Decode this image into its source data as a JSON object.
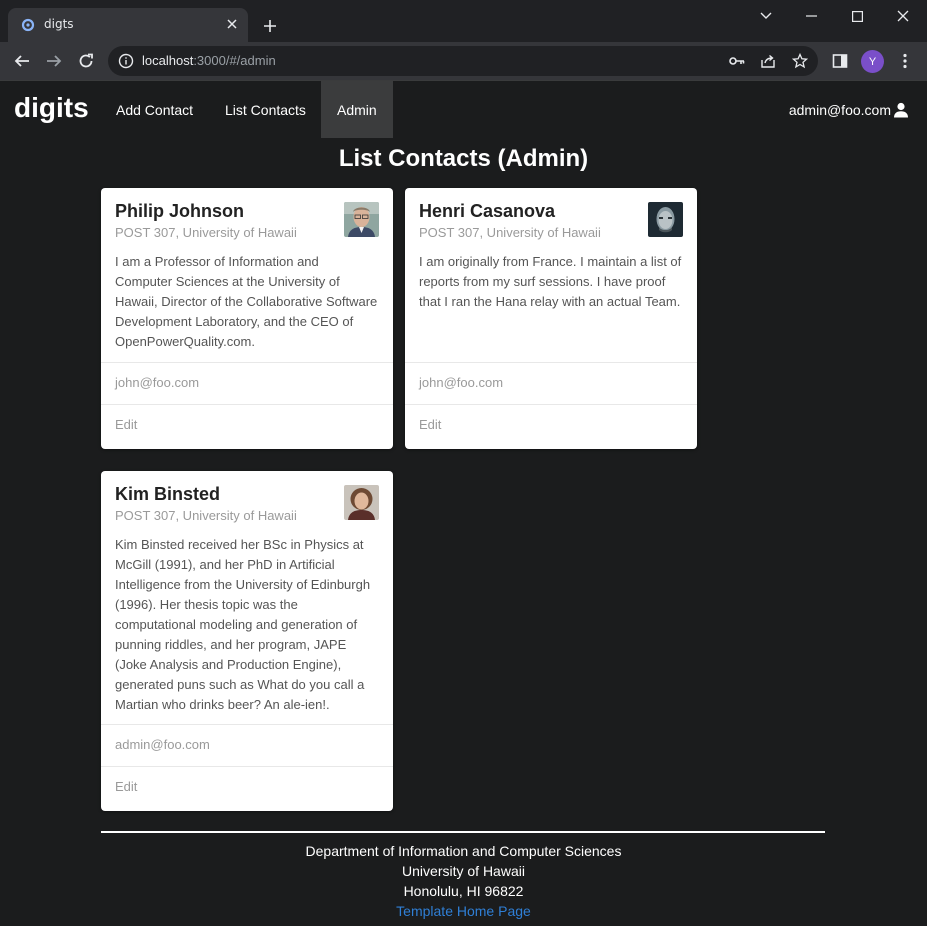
{
  "browser": {
    "tab_title": "digts",
    "url_host": "localhost",
    "url_rest": ":3000/#/admin",
    "profile_initial": "Y"
  },
  "nav": {
    "brand": "digits",
    "items": [
      {
        "label": "Add Contact"
      },
      {
        "label": "List Contacts"
      },
      {
        "label": "Admin"
      }
    ],
    "user_email": "admin@foo.com"
  },
  "page": {
    "title": "List Contacts (Admin)"
  },
  "contacts": [
    {
      "name": "Philip Johnson",
      "address": "POST 307, University of Hawaii",
      "description": "I am a Professor of Information and Computer Sciences at the University of Hawaii, Director of the Collaborative Software Development Laboratory, and the CEO of OpenPowerQuality.com.",
      "owner": "john@foo.com",
      "edit_label": "Edit"
    },
    {
      "name": "Henri Casanova",
      "address": "POST 307, University of Hawaii",
      "description": "I am originally from France. I maintain a list of reports from my surf sessions. I have proof that I ran the Hana relay with an actual Team.",
      "owner": "john@foo.com",
      "edit_label": "Edit"
    },
    {
      "name": "Kim Binsted",
      "address": "POST 307, University of Hawaii",
      "description": "Kim Binsted received her BSc in Physics at McGill (1991), and her PhD in Artificial Intelligence from the University of Edinburgh (1996). Her thesis topic was the computational modeling and generation of punning riddles, and her program, JAPE (Joke Analysis and Production Engine), generated puns such as What do you call a Martian who drinks beer? An ale-ien!.",
      "owner": "admin@foo.com",
      "edit_label": "Edit"
    }
  ],
  "footer": {
    "line1": "Department of Information and Computer Sciences",
    "line2": "University of Hawaii",
    "line3": "Honolulu, HI 96822",
    "link": "Template Home Page"
  },
  "colors": {
    "page_bg": "#1b1c1d",
    "active_nav": "#3b3c3d",
    "link": "#2f7fd6",
    "avatar": "#7a4fc9"
  }
}
